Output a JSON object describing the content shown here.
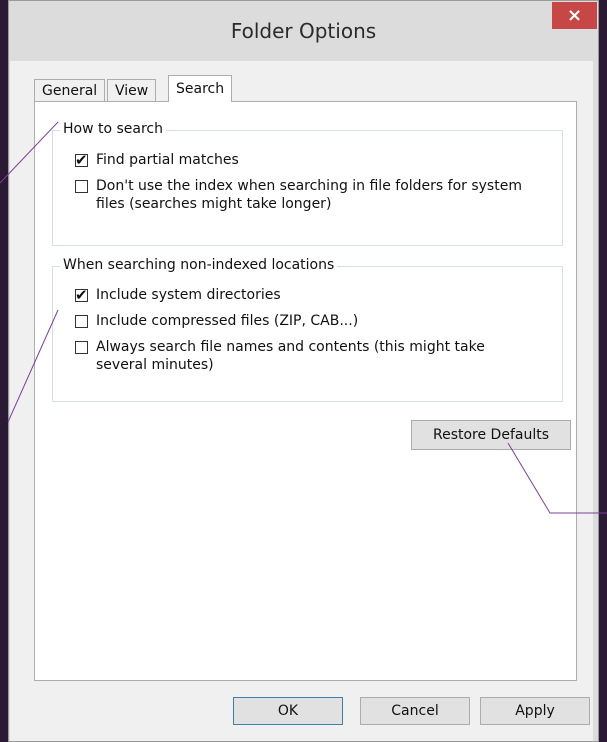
{
  "window": {
    "title": "Folder Options",
    "close_glyph": "×"
  },
  "tabs": [
    {
      "label": "General"
    },
    {
      "label": "View"
    },
    {
      "label": "Search",
      "active": true
    }
  ],
  "how_to_search": {
    "legend": "How to search",
    "options": [
      {
        "label": "Find partial matches",
        "checked": true
      },
      {
        "label": "Don't use the index when searching in file folders for system files (searches might take longer)",
        "checked": false
      }
    ]
  },
  "non_indexed": {
    "legend": "When searching non-indexed locations",
    "options": [
      {
        "label": "Include system directories",
        "checked": true
      },
      {
        "label": "Include compressed files (ZIP, CAB...)",
        "checked": false
      },
      {
        "label": "Always search file names and contents (this might take several minutes)",
        "checked": false
      }
    ]
  },
  "restore_defaults_label": "Restore Defaults",
  "footer": {
    "ok_label": "OK",
    "cancel_label": "Cancel",
    "apply_label": "Apply"
  },
  "colors": {
    "close_button": "#c74646",
    "annotation_lines": "#7b3f9a"
  },
  "checkmark": "✔"
}
